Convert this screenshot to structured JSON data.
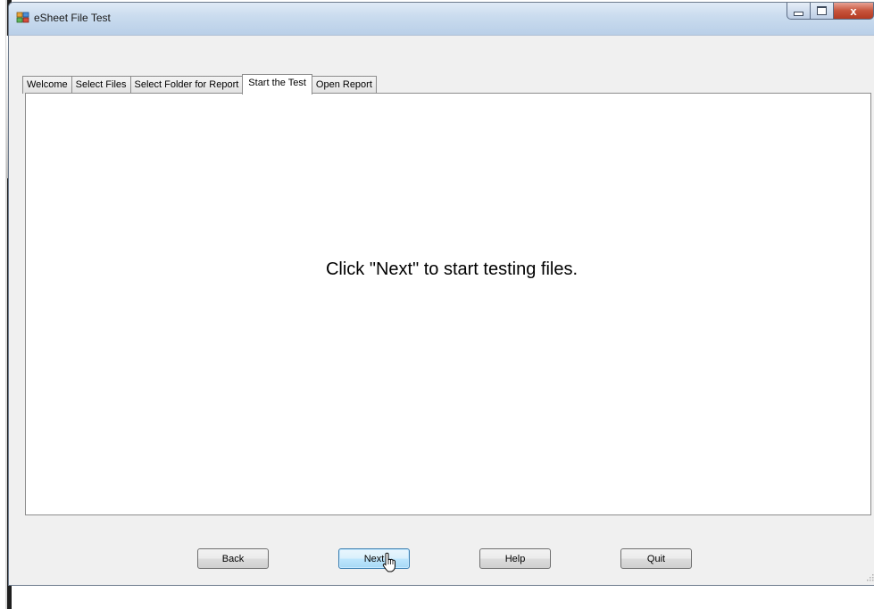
{
  "window": {
    "title": "eSheet File Test",
    "app_icon": "app-icon"
  },
  "tabs": [
    {
      "label": "Welcome",
      "active": false
    },
    {
      "label": "Select Files",
      "active": false
    },
    {
      "label": "Select Folder for Report",
      "active": false
    },
    {
      "label": "Start the Test",
      "active": true
    },
    {
      "label": "Open Report",
      "active": false
    }
  ],
  "panel": {
    "message": "Click \"Next\" to start testing files."
  },
  "buttons": {
    "back": "Back",
    "next": "Next",
    "help": "Help",
    "quit": "Quit"
  },
  "caption": {
    "close": "x"
  },
  "colors": {
    "titlebar": "#c9dbee",
    "close_button": "#c7543c",
    "default_button_border": "#3c7fb1",
    "client_background": "#f0f0f0"
  }
}
